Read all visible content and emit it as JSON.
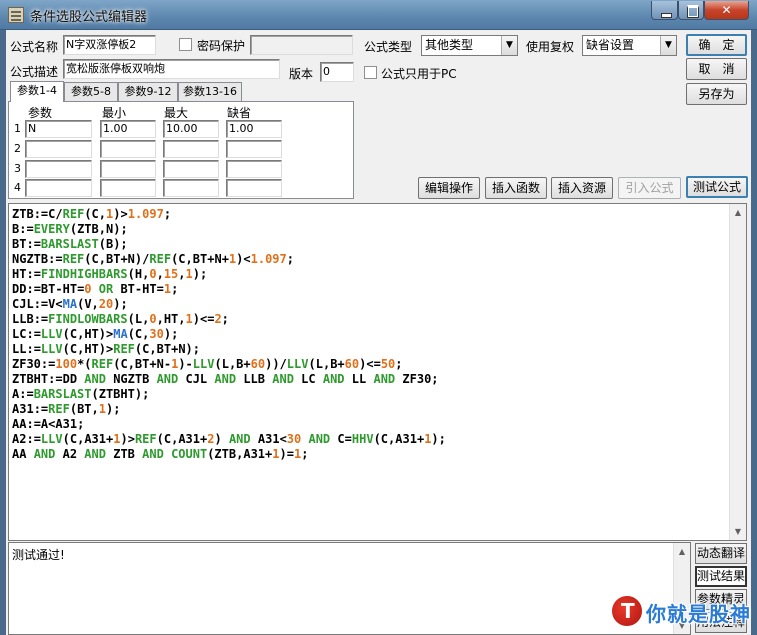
{
  "window": {
    "title": "条件选股公式编辑器"
  },
  "form": {
    "name_label": "公式名称",
    "name_value": "N字双涨停板2",
    "password_label": "密码保护",
    "type_label": "公式类型",
    "type_value": "其他类型",
    "restore_label": "使用复权",
    "restore_value": "缺省设置",
    "desc_label": "公式描述",
    "desc_value": "宽松版涨停板双响炮",
    "version_label": "版本",
    "version_value": "0",
    "pc_only_label": "公式只用于PC"
  },
  "buttons": {
    "ok": "确　定",
    "cancel": "取　消",
    "save_as": "另存为",
    "edit_ops": "编辑操作",
    "insert_func": "插入函数",
    "insert_res": "插入资源",
    "import_formula": "引入公式",
    "test_formula": "测试公式"
  },
  "tabs": [
    "参数1-4",
    "参数5-8",
    "参数9-12",
    "参数13-16"
  ],
  "params": {
    "headers": [
      "参数",
      "最小",
      "最大",
      "缺省"
    ],
    "rows": [
      {
        "num": "1",
        "name": "N",
        "min": "1.00",
        "max": "10.00",
        "default": "1.00"
      },
      {
        "num": "2",
        "name": "",
        "min": "",
        "max": "",
        "default": ""
      },
      {
        "num": "3",
        "name": "",
        "min": "",
        "max": "",
        "default": ""
      },
      {
        "num": "4",
        "name": "",
        "min": "",
        "max": "",
        "default": ""
      }
    ]
  },
  "code_lines": [
    "ZTB:=C/REF(C,1)>1.097;",
    "B:=EVERY(ZTB,N);",
    "BT:=BARSLAST(B);",
    "NGZTB:=REF(C,BT+N)/REF(C,BT+N+1)<1.097;",
    "HT:=FINDHIGHBARS(H,0,15,1);",
    "DD:=BT-HT=0 OR BT-HT=1;",
    "CJL:=V<MA(V,20);",
    "LLB:=FINDLOWBARS(L,0,HT,1)<=2;",
    "LC:=LLV(C,HT)>MA(C,30);",
    "LL:=LLV(C,HT)>REF(C,BT+N);",
    "ZF30:=100*(REF(C,BT+N-1)-LLV(L,B+60))/LLV(L,B+60)<=50;",
    "ZTBHT:=DD AND NGZTB AND CJL AND LLB AND LC AND LL AND ZF30;",
    "A:=BARSLAST(ZTBHT);",
    "A31:=REF(BT,1);",
    "AA:=A<A31;",
    "A2:=LLV(C,A31+1)>REF(C,A31+2) AND A31<30 AND C=HHV(C,A31+1);",
    "AA AND A2 AND ZTB AND COUNT(ZTB,A31+1)=1;"
  ],
  "output": {
    "text": "测试通过!"
  },
  "side_buttons": [
    "动态翻译",
    "测试结果",
    "参数精灵",
    "用法注释"
  ],
  "watermark": {
    "text": "你就是股神",
    "sub": "用法注释"
  },
  "colors": {
    "function": "#2e9a2e",
    "number": "#e0701a",
    "keyword": "#2e9a2e",
    "ma_function": "#2b72c8"
  }
}
